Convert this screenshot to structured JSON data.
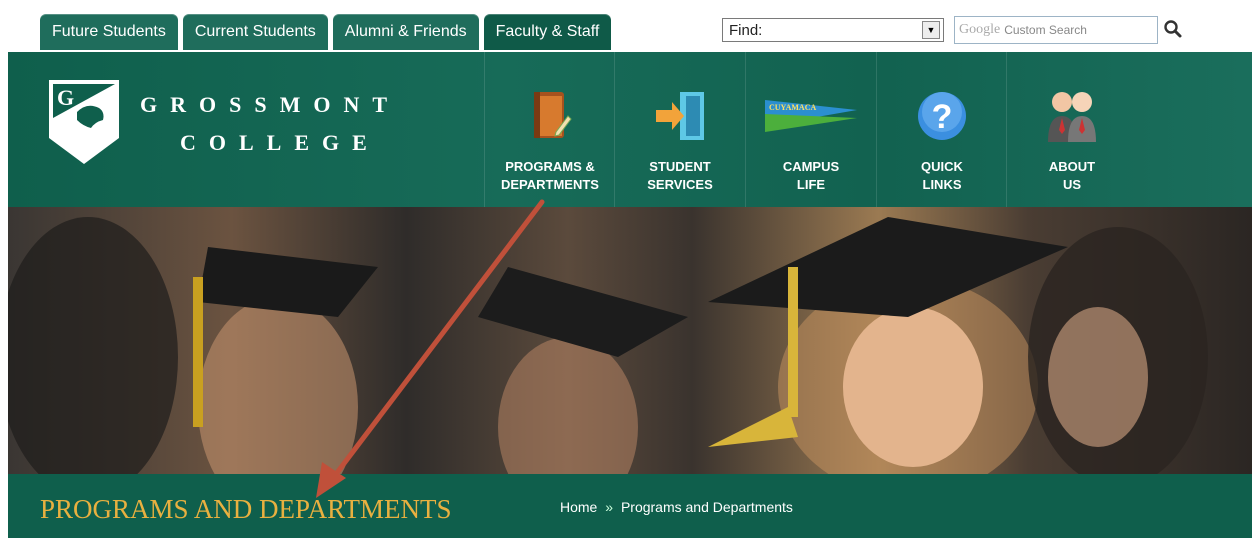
{
  "tabs": [
    "Future Students",
    "Current Students",
    "Alumni & Friends",
    "Faculty & Staff"
  ],
  "find": {
    "label": "Find:"
  },
  "search": {
    "logo": "Google",
    "placeholder": "Custom Search"
  },
  "logo": {
    "name_line1": "Grossmont",
    "name_line2": "College",
    "letter": "G"
  },
  "nav": [
    {
      "label": "PROGRAMS &\nDEPARTMENTS",
      "icon": "book-icon"
    },
    {
      "label": "STUDENT\nSERVICES",
      "icon": "door-arrow-icon"
    },
    {
      "label": "CAMPUS\nLIFE",
      "icon": "pennant-icon",
      "pennant_text": "CUYAMACA"
    },
    {
      "label": "QUICK\nLINKS",
      "icon": "question-icon"
    },
    {
      "label": "ABOUT\nUS",
      "icon": "people-icon"
    }
  ],
  "page_title": "PROGRAMS AND DEPARTMENTS",
  "breadcrumb": {
    "home": "Home",
    "separator": "»",
    "current": "Programs and Departments"
  },
  "colors": {
    "brand_green": "#0f5f4c",
    "title_gold": "#e8b040",
    "arrow": "#c0503a"
  }
}
